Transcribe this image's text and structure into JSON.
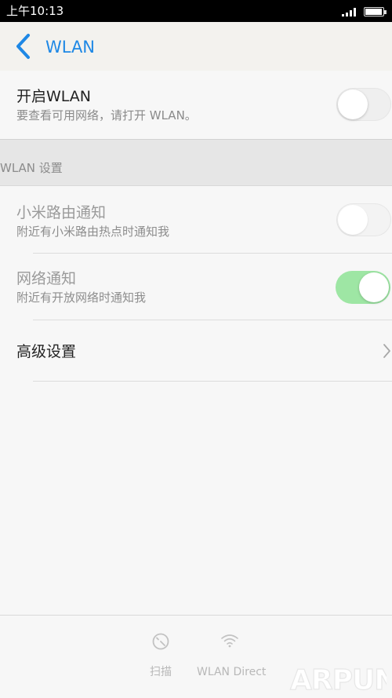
{
  "status_bar": {
    "time": "上午10:13"
  },
  "title_bar": {
    "title": "WLAN"
  },
  "wlan_toggle": {
    "label": "开启WLAN",
    "sub": "要查看可用网络，请打开 WLAN。",
    "state": "off"
  },
  "section": {
    "header": "WLAN 设置"
  },
  "settings": {
    "items": [
      {
        "label": "小米路由通知",
        "sub": "附近有小米路由热点时通知我",
        "state": "off",
        "enabled": false
      },
      {
        "label": "网络通知",
        "sub": "附近有开放网络时通知我",
        "state": "on",
        "enabled": false
      },
      {
        "label": "高级设置"
      }
    ]
  },
  "bottom_bar": {
    "scan_label": "扫描",
    "direct_label": "WLAN Direct",
    "scan_icon": "scan-icon",
    "direct_icon": "wifi-icon"
  },
  "watermark": {
    "text": "ARPUN"
  },
  "colors": {
    "accent": "#1e88e5",
    "toggle_on": "#9ee6a4",
    "status_bar": "#000000"
  }
}
